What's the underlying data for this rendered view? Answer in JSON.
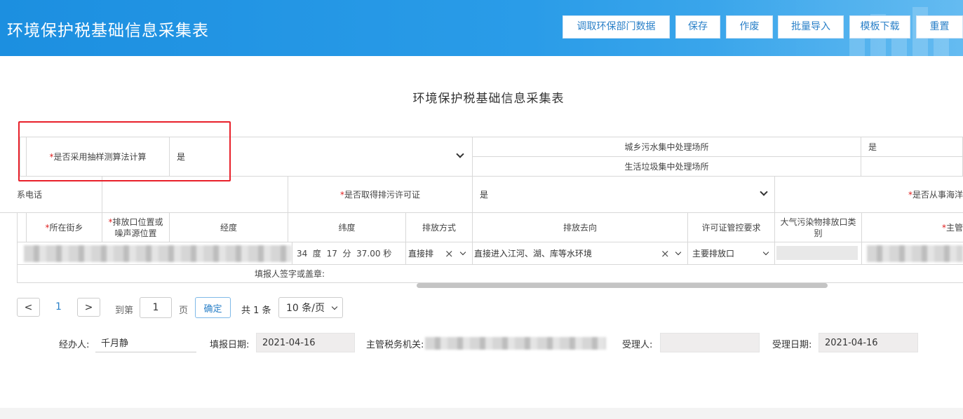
{
  "header": {
    "title": "环境保护税基础信息采集表",
    "buttons": [
      "调取环保部门数据",
      "保存",
      "作废",
      "批量导入",
      "模板下载",
      "重置"
    ]
  },
  "form_title": "环境保护税基础信息采集表",
  "row1": {
    "sampling_label": "是否采用抽样测算法计算",
    "sampling_value": "是",
    "sewage_label": "城乡污水集中处理场所",
    "sewage_value": "是",
    "garbage_label": "生活垃圾集中处理场所"
  },
  "row2": {
    "phone_label": "系电话",
    "permit_label": "是否取得排污许可证",
    "permit_value": "是",
    "marine_label": "是否从事海洋"
  },
  "columns": {
    "street": "所在街乡",
    "outlet_position": "排放口位置或噪声源位置",
    "longitude": "经度",
    "latitude": "纬度",
    "method": "排放方式",
    "destination": "排放去向",
    "permit_req": "许可证管控要求",
    "air_outlet": "大气污染物排放口类别",
    "main": "主管"
  },
  "data_row": {
    "lat_deg": "34",
    "lat_deg_unit": "度",
    "lat_min": "17",
    "lat_min_unit": "分",
    "lat_sec": "37.00",
    "lat_sec_unit": "秒",
    "method": "直接排",
    "destination": "直接进入江河、湖、库等水环境",
    "permit_req": "主要排放口"
  },
  "signature_label": "填报人签字或盖章:",
  "pagination": {
    "prev": "<",
    "current": "1",
    "next": ">",
    "goto_label": "到第",
    "goto_value": "1",
    "page_unit": "页",
    "confirm": "确定",
    "total": "共 1 条",
    "page_size": "10 条/页"
  },
  "footer": {
    "handler_label": "经办人:",
    "handler_value": "千月静",
    "fill_date_label": "填报日期:",
    "fill_date_value": "2021-04-16",
    "tax_office_label": "主管税务机关:",
    "acceptor_label": "受理人:",
    "accept_date_label": "受理日期:",
    "accept_date_value": "2021-04-16"
  }
}
